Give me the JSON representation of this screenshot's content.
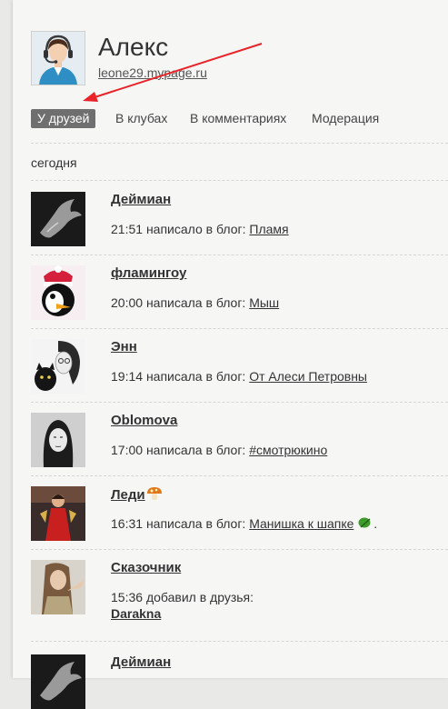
{
  "profile": {
    "name": "Алекс",
    "link": "leone29.mypage.ru",
    "avatar_icon": "support-operator-avatar"
  },
  "tabs": [
    {
      "label": "У друзей",
      "active": true
    },
    {
      "label": "В клубах",
      "active": false
    },
    {
      "label": "В комментариях",
      "active": false
    },
    {
      "label": "Модерация",
      "active": false
    }
  ],
  "feed": {
    "date_label": "сегодня",
    "items": [
      {
        "user": "Деймиан",
        "time": "21:51",
        "action": "написало в блог:",
        "target": "Пламя"
      },
      {
        "user": "фламингоу",
        "time": "20:00",
        "action": "написала в блог:",
        "target": "Мыш"
      },
      {
        "user": "Энн",
        "time": "19:14",
        "action": "написала в блог:",
        "target": "От Алеси Петровны"
      },
      {
        "user": "Oblomova",
        "time": "17:00",
        "action": "написала в блог:",
        "target": "#смотрюкино"
      },
      {
        "user": "Леди",
        "time": "16:31",
        "action": "написала в блог:",
        "target": "Манишка к шапке",
        "suffix": "."
      },
      {
        "user": "Сказочник",
        "time": "15:36",
        "action": "добавил в друзья:",
        "target": "Darakna"
      },
      {
        "user": "Деймиан"
      }
    ]
  },
  "colors": {
    "active_tab_bg": "#6f6f6f",
    "annotation_arrow": "#e8242a"
  }
}
